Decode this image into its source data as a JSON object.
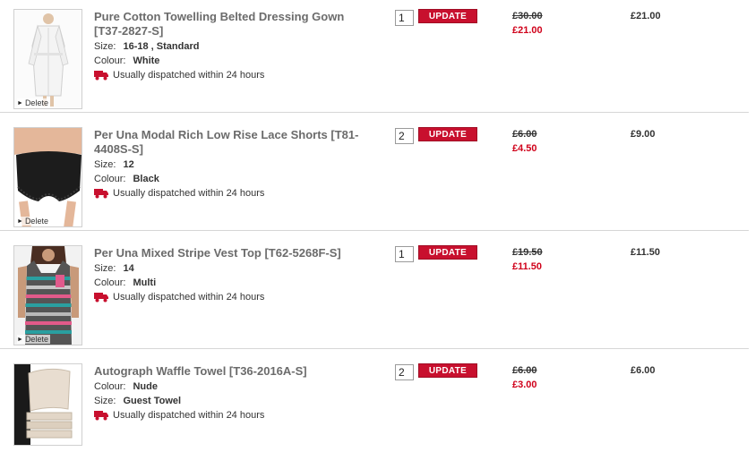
{
  "colors": {
    "accent": "#c8102e",
    "sale_price": "#d0021b",
    "title": "#6b6b6b"
  },
  "delete_label": "Delete",
  "dispatch_text": "Usually dispatched within 24 hours",
  "update_label": "UPDATE",
  "items": [
    {
      "title": "Pure Cotton Towelling Belted Dressing Gown [T37-2827-S]",
      "attrs": [
        {
          "label": "Size:",
          "value": "16-18 , Standard"
        },
        {
          "label": "Colour:",
          "value": "White"
        }
      ],
      "qty": "1",
      "was": "£30.00",
      "now": "£21.00",
      "total": "£21.00",
      "icon": "dressing-gown-image"
    },
    {
      "title": "Per Una Modal Rich Low Rise Lace Shorts [T81-4408S-S]",
      "attrs": [
        {
          "label": "Size:",
          "value": "12"
        },
        {
          "label": "Colour:",
          "value": "Black"
        }
      ],
      "qty": "2",
      "was": "£6.00",
      "now": "£4.50",
      "total": "£9.00",
      "icon": "lace-shorts-image"
    },
    {
      "title": "Per Una Mixed Stripe Vest Top [T62-5268F-S]",
      "attrs": [
        {
          "label": "Size:",
          "value": "14"
        },
        {
          "label": "Colour:",
          "value": "Multi"
        }
      ],
      "qty": "1",
      "was": "£19.50",
      "now": "£11.50",
      "total": "£11.50",
      "icon": "vest-top-image"
    },
    {
      "title": "Autograph Waffle Towel [T36-2016A-S]",
      "attrs": [
        {
          "label": "Colour:",
          "value": "Nude"
        },
        {
          "label": "Size:",
          "value": "Guest Towel"
        }
      ],
      "qty": "2",
      "was": "£6.00",
      "now": "£3.00",
      "total": "£6.00",
      "icon": "towel-image"
    }
  ]
}
